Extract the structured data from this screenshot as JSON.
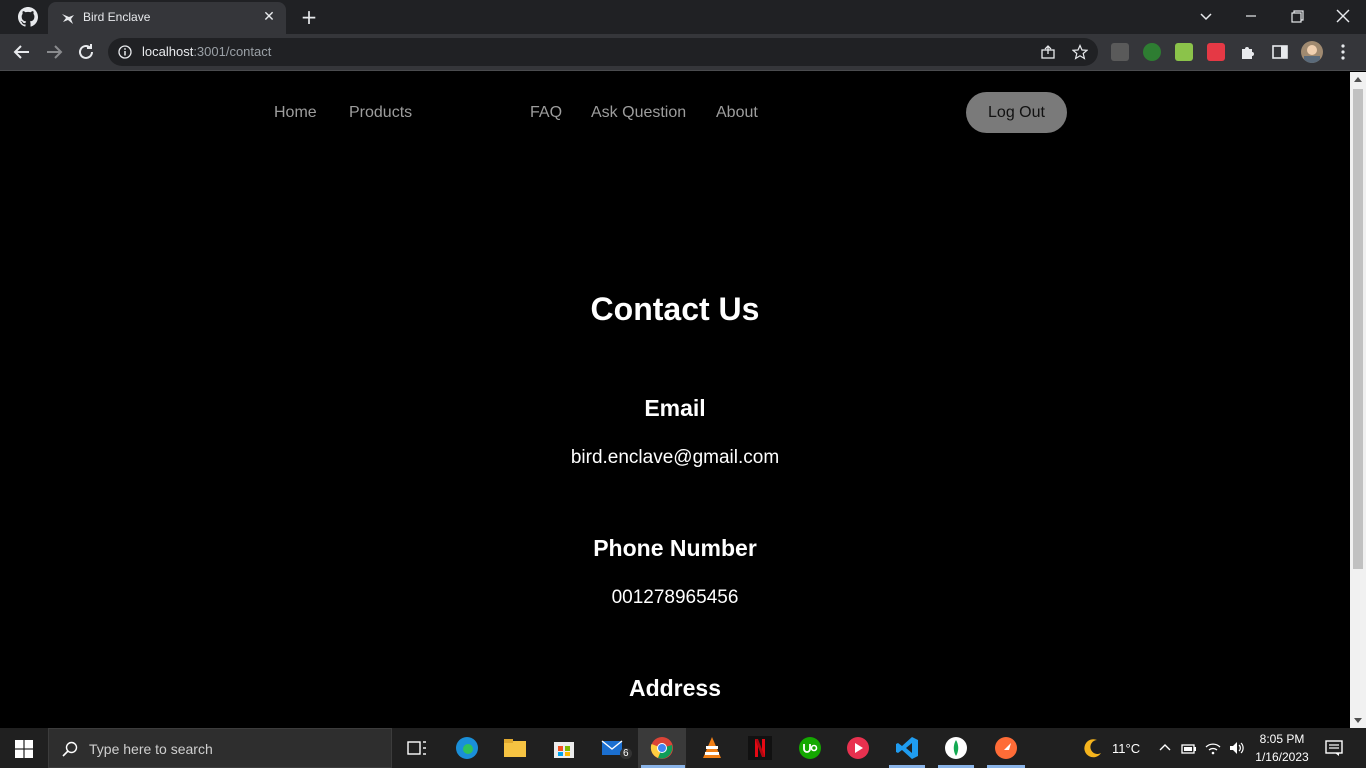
{
  "browser": {
    "tab_title": "Bird Enclave",
    "url_host": "localhost",
    "url_rest": ":3001/contact"
  },
  "nav": {
    "links": [
      "Home",
      "Products",
      "FAQ",
      "Ask Question",
      "About"
    ],
    "logout_label": "Log Out"
  },
  "contact": {
    "title": "Contact Us",
    "email_heading": "Email",
    "email_value": "bird.enclave@gmail.com",
    "phone_heading": "Phone Number",
    "phone_value": "001278965456",
    "address_heading": "Address"
  },
  "taskbar": {
    "search_placeholder": "Type here to search",
    "mail_badge": "6",
    "weather": "11°C",
    "time": "8:05 PM",
    "date": "1/16/2023"
  },
  "colors": {
    "page_bg": "#000000",
    "button_bg": "#7a7a7a",
    "nav_link": "#9d9d9d"
  }
}
